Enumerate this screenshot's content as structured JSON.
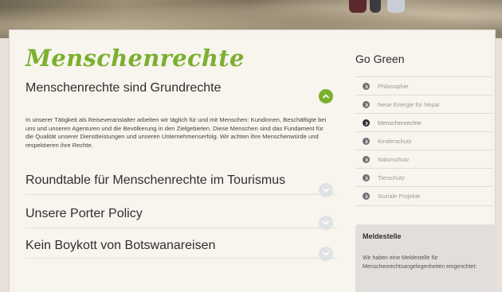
{
  "main": {
    "title": "Menschenrechte",
    "sections": [
      {
        "heading": "Menschenrechte sind Grundrechte",
        "expanded": true,
        "body": "In unserer Tätigkeit als Reiseveranstalter arbeiten wir täglich für und mit Menschen: Kundinnen, Beschäftigte bei uns und unseren Agenturen und die Bevölkerung in den Zielgebieten. Diese Menschen sind das Fundament für die Qualität unserer Dienstleistungen und unseren Unternehmenserfolg. Wir achten ihre Menschenwürde und respektieren ihre Rechte."
      },
      {
        "heading": "Roundtable für Menschenrechte im Tourismus",
        "expanded": false
      },
      {
        "heading": "Unsere Porter Policy",
        "expanded": false
      },
      {
        "heading": "Kein Boykott von Botswanareisen",
        "expanded": false
      }
    ]
  },
  "sidebar": {
    "title": "Go Green",
    "items": [
      {
        "label": "Philosophie",
        "active": false
      },
      {
        "label": "Neue Energie für Nepal",
        "active": false
      },
      {
        "label": "Menschenrechte",
        "active": true
      },
      {
        "label": "Kinderschutz",
        "active": false
      },
      {
        "label": "Naturschutz",
        "active": false
      },
      {
        "label": "Tierschutz",
        "active": false
      },
      {
        "label": "Soziale Projekte",
        "active": false
      }
    ],
    "box": {
      "title": "Meldestelle",
      "text": "Wir haben eine Meldestelle für Menschenrechtsangelegenheiten eingerichtet:"
    }
  },
  "colors": {
    "accent": "#7ab02e",
    "page_bg": "#f8f4ee",
    "box_bg": "#e2dedb"
  },
  "icons": {
    "expanded": "chevron-up-icon",
    "collapsed": "chevron-down-icon",
    "nav": "chevron-right-icon"
  }
}
